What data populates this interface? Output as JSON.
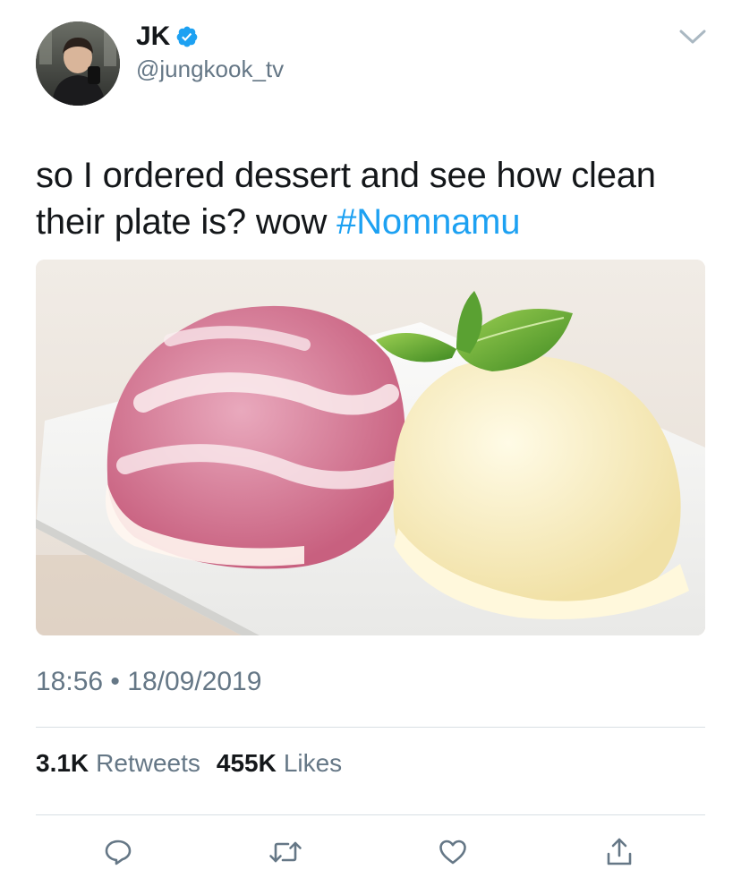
{
  "author": {
    "display_name": "JK",
    "handle": "@jungkook_tv",
    "verified": true,
    "avatar_icon": "avatar"
  },
  "tweet": {
    "text_before": "so I ordered dessert and see how clean their plate is? wow ",
    "hashtag": "#Nomnamu",
    "time": "18:56",
    "separator": "•",
    "date": "18/09/2019"
  },
  "stats": {
    "retweets_count": "3.1K",
    "retweets_label": "Retweets",
    "likes_count": "455K",
    "likes_label": "Likes"
  },
  "actions": [
    {
      "icon": "reply-icon"
    },
    {
      "icon": "retweet-icon"
    },
    {
      "icon": "like-icon"
    },
    {
      "icon": "share-icon"
    }
  ],
  "colors": {
    "accent": "#1da1f2",
    "text": "#14171a",
    "secondary": "#657786",
    "divider": "#d8dfe4"
  }
}
